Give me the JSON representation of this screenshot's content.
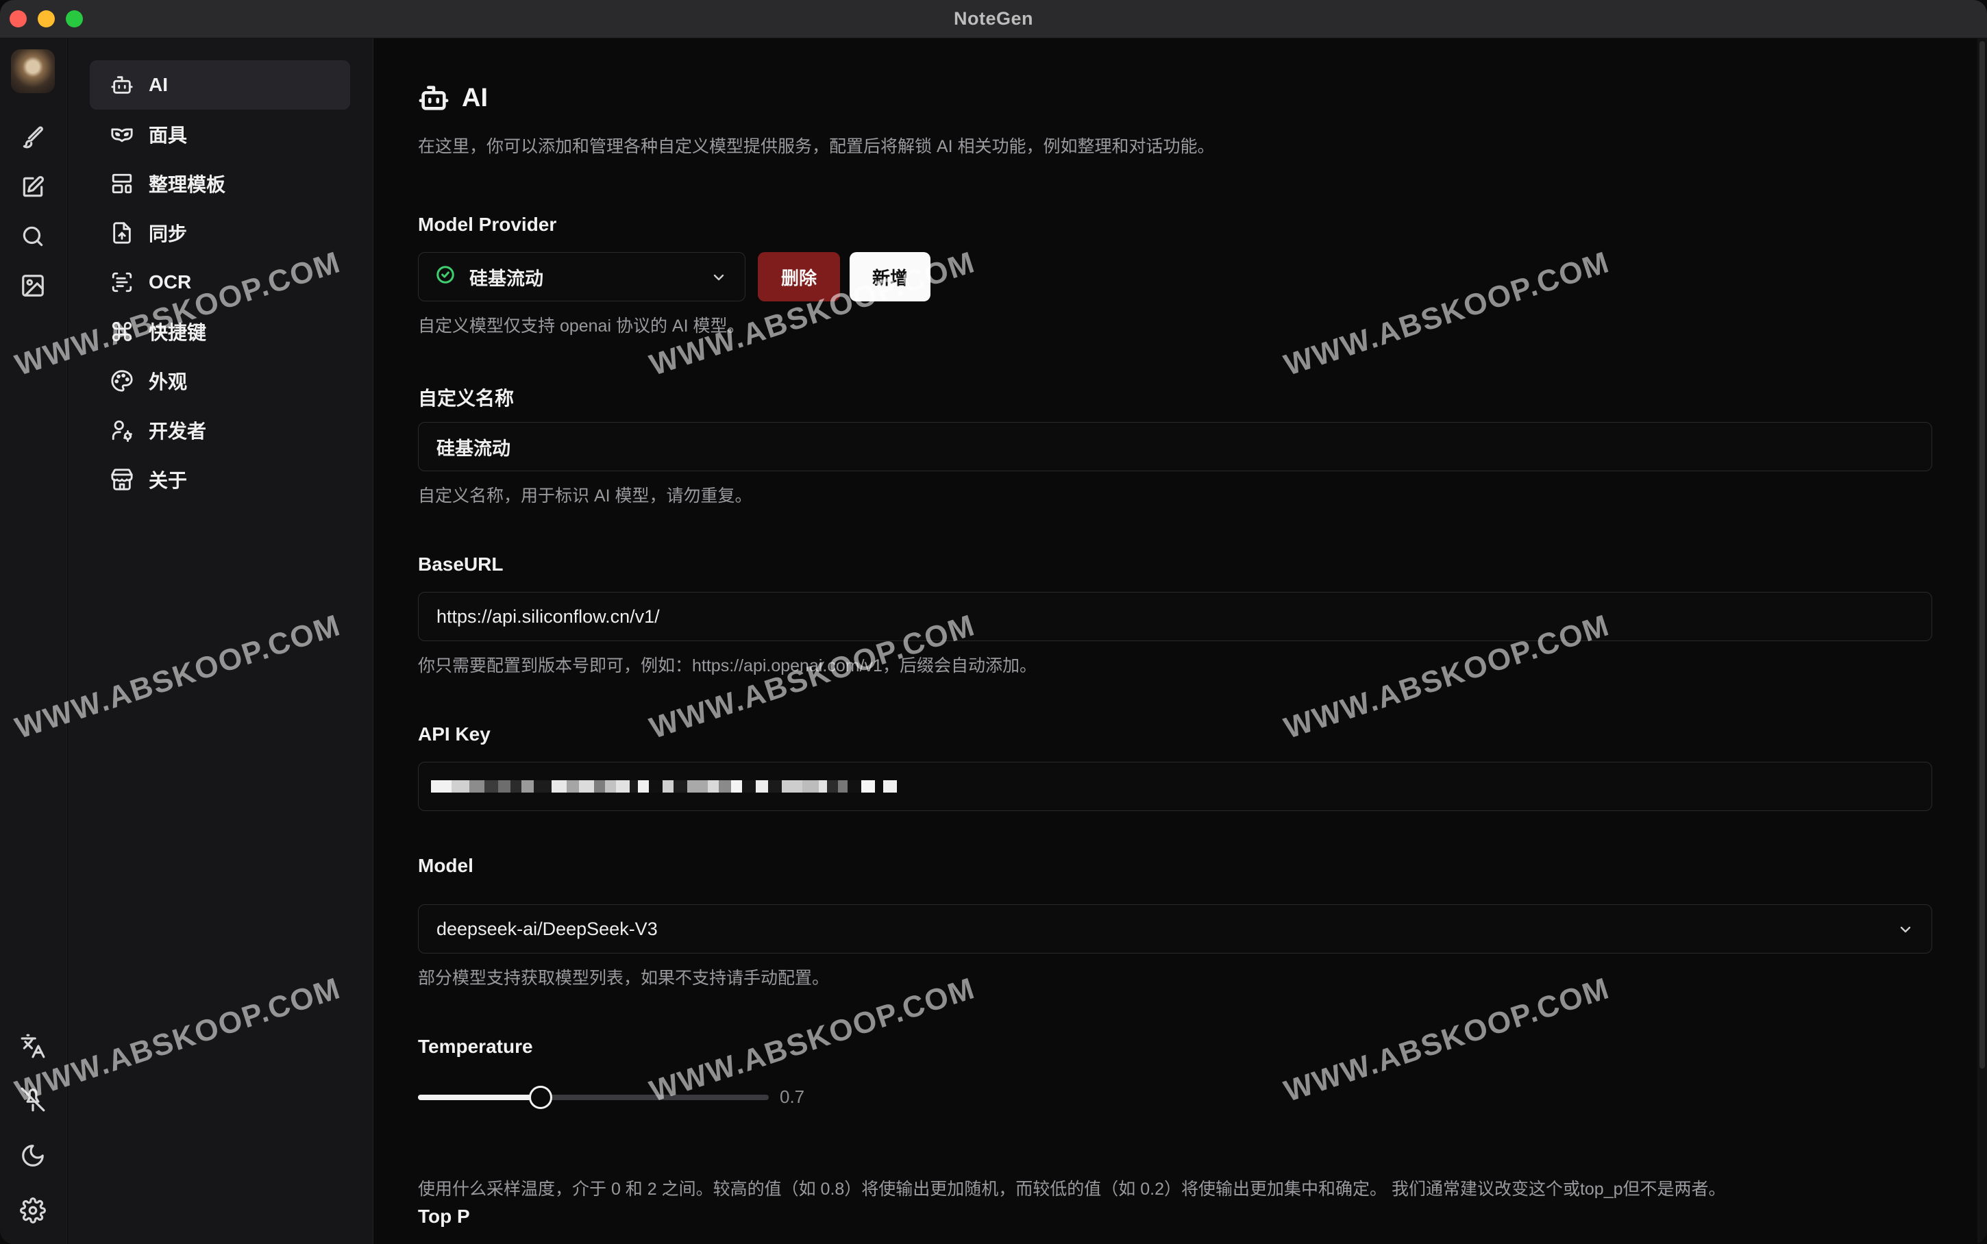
{
  "window": {
    "title": "NoteGen"
  },
  "settings_nav": {
    "items": [
      {
        "label": "AI",
        "icon": "bot-icon",
        "active": true
      },
      {
        "label": "面具",
        "icon": "mask-icon",
        "active": false
      },
      {
        "label": "整理模板",
        "icon": "template-icon",
        "active": false
      },
      {
        "label": "同步",
        "icon": "sync-file-icon",
        "active": false
      },
      {
        "label": "OCR",
        "icon": "scan-text-icon",
        "active": false
      },
      {
        "label": "快捷键",
        "icon": "command-icon",
        "active": false
      },
      {
        "label": "外观",
        "icon": "palette-icon",
        "active": false
      },
      {
        "label": "开发者",
        "icon": "user-cog-icon",
        "active": false
      },
      {
        "label": "关于",
        "icon": "store-icon",
        "active": false
      }
    ]
  },
  "page": {
    "title": "AI",
    "description": "在这里，你可以添加和管理各种自定义模型提供服务，配置后将解锁 AI 相关功能，例如整理和对话功能。"
  },
  "model_provider": {
    "label": "Model Provider",
    "selected": "硅基流动",
    "delete_label": "删除",
    "add_label": "新增",
    "hint": "自定义模型仅支持 openai 协议的 AI 模型。"
  },
  "custom_name": {
    "label": "自定义名称",
    "value": "硅基流动",
    "hint": "自定义名称，用于标识 AI 模型，请勿重复。"
  },
  "base_url": {
    "label": "BaseURL",
    "value": "https://api.siliconflow.cn/v1/",
    "hint": "你只需要配置到版本号即可，例如：https://api.openai.com/v1，后缀会自动添加。"
  },
  "api_key": {
    "label": "API Key"
  },
  "model": {
    "label": "Model",
    "value": "deepseek-ai/DeepSeek-V3",
    "hint": "部分模型支持获取模型列表，如果不支持请手动配置。"
  },
  "temperature": {
    "label": "Temperature",
    "value": 0.7,
    "value_text": "0.7",
    "min": 0,
    "max": 2,
    "hint": "使用什么采样温度，介于 0 和 2 之间。较高的值（如 0.8）将使输出更加随机，而较低的值（如 0.2）将使输出更加集中和确定。 我们通常建议改变这个或top_p但不是两者。"
  },
  "top_p": {
    "label": "Top P"
  },
  "watermark": {
    "text": "WWW.ABSKOOP.COM"
  }
}
